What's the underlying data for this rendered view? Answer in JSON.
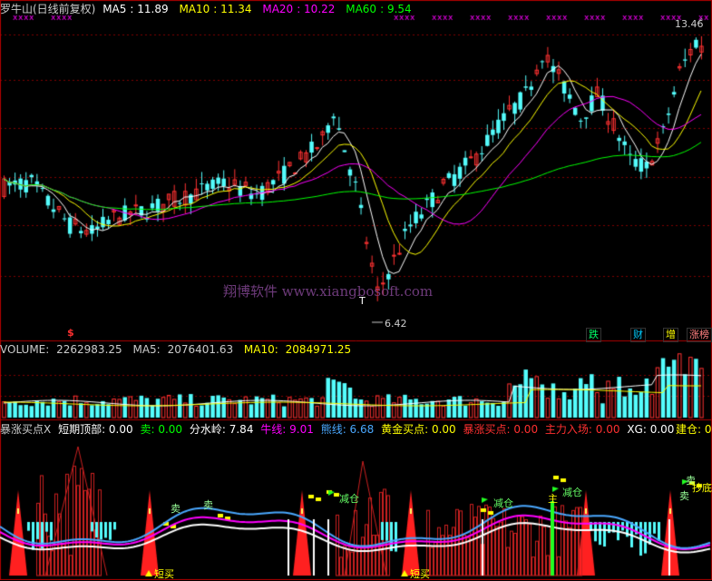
{
  "stock": {
    "title": "罗牛山(日线前复权)",
    "ma_labels": [
      {
        "name": "MA5",
        "value": "11.89",
        "color": "#ffffff"
      },
      {
        "name": "MA10",
        "value": "11.34",
        "color": "#ffff00"
      },
      {
        "name": "MA20",
        "value": "10.22",
        "color": "#ff00ff"
      },
      {
        "name": "MA60",
        "value": "9.54",
        "color": "#00ff00"
      }
    ],
    "high_label": "13.46",
    "low_label": "6.42",
    "watermark": "翔博软件 www.xiangbosoft.com",
    "cursor_label": "T",
    "marker_dollar": "$",
    "tags": [
      {
        "text": "跌",
        "color": "#00ff66"
      },
      {
        "text": "财",
        "color": "#00ccff"
      },
      {
        "text": "增",
        "color": "#ffff00"
      },
      {
        "text": "涨榜",
        "color": "#ff8080"
      }
    ]
  },
  "volume": {
    "label": "VOLUME:",
    "value": "2262983.25",
    "ma5_label": "MA5:",
    "ma5_value": "2076401.63",
    "ma10_label": "MA10:",
    "ma10_value": "2084971.25"
  },
  "indicator": {
    "items": [
      {
        "text": "暴涨买点X",
        "color": "#cccccc"
      },
      {
        "text": "短期顶部: 0.00",
        "color": "#ffffff"
      },
      {
        "text": "卖: 0.00",
        "color": "#00ff00"
      },
      {
        "text": "分水岭: 7.84",
        "color": "#ffffff"
      },
      {
        "text": "牛线: 9.01",
        "color": "#ff00ff"
      },
      {
        "text": "熊线: 6.68",
        "color": "#4aa8ff"
      },
      {
        "text": "黄金买点: 0.00",
        "color": "#ffff00"
      },
      {
        "text": "暴涨买点: 0.00",
        "color": "#ff3030"
      },
      {
        "text": "主力入场: 0.00",
        "color": "#ff3030"
      },
      {
        "text": "XG: 0.00",
        "color": "#ffffff"
      },
      {
        "text": "建仓: 0.",
        "color": "#ffff00"
      }
    ],
    "signals": [
      {
        "text": "减仓",
        "color": "#66ff66"
      },
      {
        "text": "减仓",
        "color": "#66ff66"
      },
      {
        "text": "减仓",
        "color": "#66ff66"
      },
      {
        "text": "短买",
        "color": "#ffff00"
      },
      {
        "text": "短买",
        "color": "#ffff00"
      },
      {
        "text": "卖",
        "color": "#99ff99"
      },
      {
        "text": "卖",
        "color": "#99ff99"
      },
      {
        "text": "卖",
        "color": "#99ff99"
      },
      {
        "text": "卖",
        "color": "#99ff99"
      },
      {
        "text": "抄底",
        "color": "#ffff00"
      },
      {
        "text": "主",
        "color": "#ffff00"
      }
    ]
  },
  "colors": {
    "up": "#ff3232",
    "down": "#54fcfc",
    "grid": "#800000",
    "divider": "#b00000"
  }
}
